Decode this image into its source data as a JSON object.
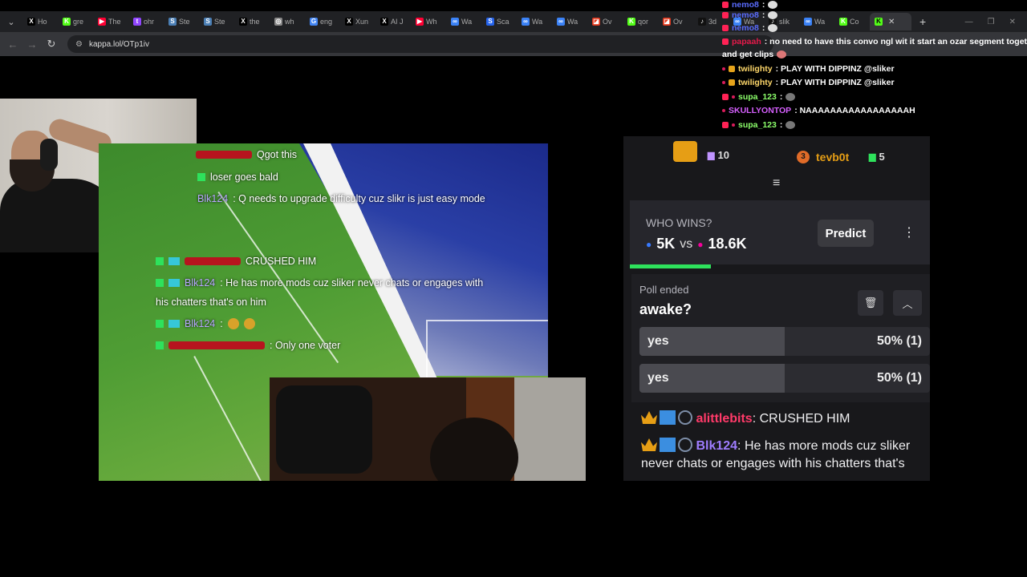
{
  "browser": {
    "tabs": [
      {
        "icon": "x-icon",
        "label": "Ho",
        "color": "#000000",
        "glyph": "X"
      },
      {
        "icon": "kick-icon",
        "label": "gre",
        "color": "#53fc18",
        "glyph": "K"
      },
      {
        "icon": "youtube-icon",
        "label": "The",
        "color": "#ff0033",
        "glyph": "▶"
      },
      {
        "icon": "twitch-icon",
        "label": "ohr",
        "color": "#9146ff",
        "glyph": "t"
      },
      {
        "icon": "steam-icon",
        "label": "Ste",
        "color": "#4b7fb5",
        "glyph": "S"
      },
      {
        "icon": "steam-icon",
        "label": "Ste",
        "color": "#4b7fb5",
        "glyph": "S"
      },
      {
        "icon": "x-icon",
        "label": "the",
        "color": "#000000",
        "glyph": "X"
      },
      {
        "icon": "globe-icon",
        "label": "wh",
        "color": "#888888",
        "glyph": "◎"
      },
      {
        "icon": "google-icon",
        "label": "eng",
        "color": "#4285f4",
        "glyph": "G"
      },
      {
        "icon": "x-icon",
        "label": "Xun",
        "color": "#000000",
        "glyph": "X"
      },
      {
        "icon": "x-icon",
        "label": "AI J",
        "color": "#000000",
        "glyph": "X"
      },
      {
        "icon": "youtube-icon",
        "label": "Wh",
        "color": "#ff0033",
        "glyph": "▶"
      },
      {
        "icon": "wa-icon",
        "label": "Wa",
        "color": "#3b82f6",
        "glyph": "∞"
      },
      {
        "icon": "sca-icon",
        "label": "Sca",
        "color": "#2563eb",
        "glyph": "S"
      },
      {
        "icon": "wa-icon",
        "label": "Wa",
        "color": "#3b82f6",
        "glyph": "∞"
      },
      {
        "icon": "wa-icon",
        "label": "Wa",
        "color": "#3b82f6",
        "glyph": "∞"
      },
      {
        "icon": "overwolf-icon",
        "label": "Ov",
        "color": "#e0361b",
        "glyph": "◪"
      },
      {
        "icon": "kick-icon",
        "label": "qor",
        "color": "#53fc18",
        "glyph": "K"
      },
      {
        "icon": "overwolf-icon",
        "label": "Ov",
        "color": "#e0361b",
        "glyph": "◪"
      },
      {
        "icon": "tiktok-icon",
        "label": "3d",
        "color": "#111111",
        "glyph": "♪"
      },
      {
        "icon": "wa-icon",
        "label": "Wa",
        "color": "#3b82f6",
        "glyph": "∞"
      },
      {
        "icon": "tiktok-icon",
        "label": "slik",
        "color": "#111111",
        "glyph": "♪"
      },
      {
        "icon": "wa-icon",
        "label": "Wa",
        "color": "#3b82f6",
        "glyph": "∞"
      },
      {
        "icon": "kick-icon",
        "label": "Co",
        "color": "#53fc18",
        "glyph": "K"
      }
    ],
    "active_tab_icon": "kick-icon",
    "url": "kappa.lol/OTp1iv"
  },
  "video_overlay_chat": {
    "lines": [
      {
        "name": "",
        "text": "Qgot this"
      },
      {
        "name": "",
        "text": "loser goes bald"
      },
      {
        "name": "Blk124",
        "text": ": Q needs to upgrade difficulty cuz slikr is just easy mode"
      },
      {
        "name": "",
        "text": "CRUSHED HIM"
      },
      {
        "name": "Blk124",
        "text": ": He has more mods cuz sliker never chats or engages with"
      },
      {
        "name": "",
        "text": "his chatters that's on him"
      },
      {
        "name": "Blk124",
        "text": ":"
      },
      {
        "name": "",
        "text": ": Only one voter"
      }
    ]
  },
  "leaderboard": {
    "first_gifts": "10",
    "third_rank": "3",
    "third_user": "tevb0t",
    "third_gifts": "5"
  },
  "prediction": {
    "title": "WHO WINS?",
    "left_votes": "5K",
    "vs": "vs",
    "right_votes": "18.6K",
    "button": "Predict",
    "progress_fraction": 0.27,
    "colors": {
      "left": "#387aff",
      "right": "#f5009b",
      "progress": "#2ee25c"
    }
  },
  "poll": {
    "status": "Poll ended",
    "question": "awake?",
    "options": [
      {
        "label": "yes",
        "result": "50% (1)",
        "fraction": 0.5
      },
      {
        "label": "yes",
        "result": "50% (1)",
        "fraction": 0.5
      }
    ]
  },
  "chat": {
    "messages": [
      {
        "user": "alittlebits",
        "text": ": CRUSHED HIM"
      },
      {
        "user": "Blk124",
        "text": ": He has more mods cuz sliker never chats or engages with his chatters that's"
      }
    ]
  },
  "stream_overlay_chat": {
    "lines": [
      {
        "user": "nemo8",
        "text": ":"
      },
      {
        "user": "nemo8",
        "text": ":"
      },
      {
        "user": "nemo8",
        "text": ":"
      },
      {
        "user": "papaah",
        "text": ": no need to have this convo ngl wit it start an ozar segment together"
      },
      {
        "user": "",
        "text": "and get clips"
      },
      {
        "user": "twilighty",
        "text": ": PLAY WITH DIPPINZ @sliker"
      },
      {
        "user": "twilighty",
        "text": ": PLAY WITH DIPPINZ @sliker"
      },
      {
        "user": "supa_123",
        "text": ":"
      },
      {
        "user": "SKULLYONTOP",
        "text": ": NAAAAAAAAAAAAAAAAAH"
      },
      {
        "user": "supa_123",
        "text": ":"
      }
    ]
  }
}
